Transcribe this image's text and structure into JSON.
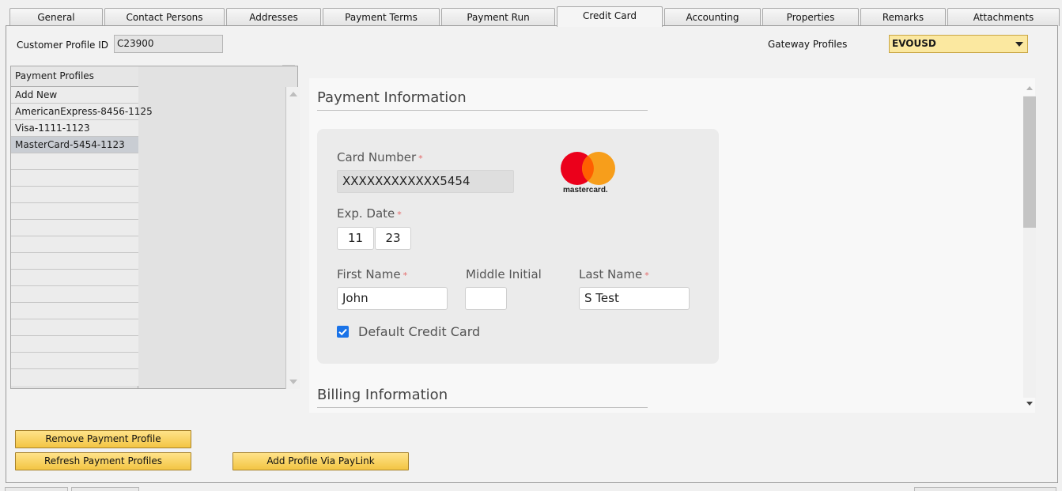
{
  "tabs": [
    {
      "label": "General",
      "active": false
    },
    {
      "label": "Contact Persons",
      "active": false
    },
    {
      "label": "Addresses",
      "active": false
    },
    {
      "label": "Payment Terms",
      "active": false
    },
    {
      "label": "Payment Run",
      "active": false
    },
    {
      "label": "Credit Card",
      "active": true
    },
    {
      "label": "Accounting",
      "active": false
    },
    {
      "label": "Properties",
      "active": false
    },
    {
      "label": "Remarks",
      "active": false
    },
    {
      "label": "Attachments",
      "active": false
    }
  ],
  "header": {
    "customer_profile_label": "Customer Profile ID",
    "customer_profile_value": "C23900",
    "gateway_label": "Gateway Profiles",
    "gateway_value": "EVOUSD"
  },
  "profiles": {
    "header": "Payment Profiles",
    "items": [
      {
        "label": "Add New"
      },
      {
        "label": "AmericanExpress-8456-1125"
      },
      {
        "label": "Visa-1111-1123"
      },
      {
        "label": "MasterCard-5454-1123"
      }
    ],
    "selected_index": 3
  },
  "payment": {
    "title": "Payment Information",
    "card_number_label": "Card Number",
    "card_number_value": "XXXXXXXXXXXX5454",
    "brand_text": "mastercard.",
    "exp_label": "Exp. Date",
    "exp_month": "11",
    "exp_year": "23",
    "first_name_label": "First Name",
    "first_name_value": "John",
    "middle_initial_label": "Middle Initial",
    "middle_initial_value": "",
    "last_name_label": "Last Name",
    "last_name_value": "S Test",
    "default_label": "Default Credit Card",
    "default_checked": true,
    "required_mark": "*"
  },
  "billing": {
    "title": "Billing Information"
  },
  "buttons": {
    "remove": "Remove Payment Profile",
    "refresh": "Refresh Payment Profiles",
    "paylink": "Add Profile Via PayLink"
  },
  "colors": {
    "button": "#f6c84a",
    "gateway_field": "#fbe8a0",
    "checkbox": "#1a73e8",
    "mc_red": "#eb001b",
    "mc_orange": "#f79e1b"
  }
}
